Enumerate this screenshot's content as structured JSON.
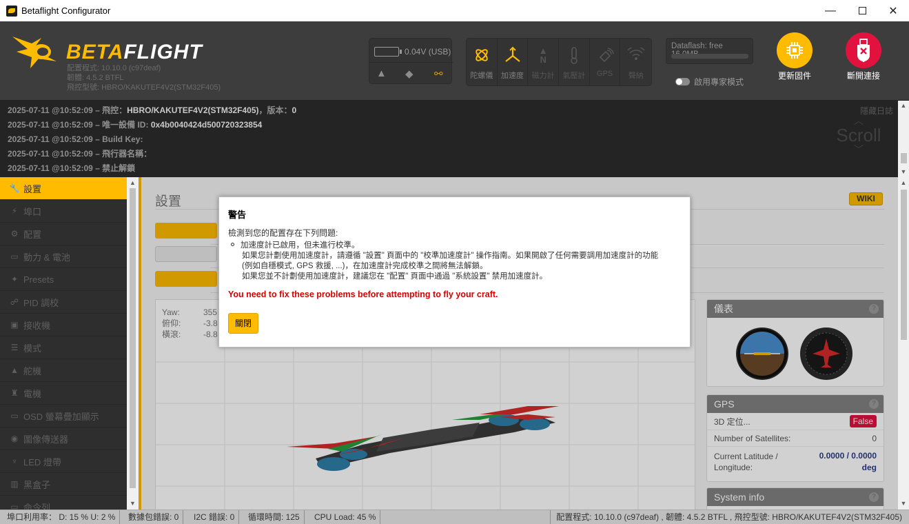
{
  "window": {
    "title": "Betaflight Configurator",
    "minimize_glyph": "—",
    "close_glyph": "✕"
  },
  "header": {
    "logo_text_a": "BETA",
    "logo_text_b": "FLIGHT",
    "info": [
      "配置程式: 10.10.0 (c97deaf)",
      "韌體: 4.5.2 BTFL",
      "飛控型號: HBRO/KAKUTEF4V2(STM32F405)"
    ],
    "battery_label": "0.04V (USB)",
    "sensors": [
      {
        "label": "陀螺儀",
        "icon": "gyro-icon",
        "active": true
      },
      {
        "label": "加速度",
        "icon": "accel-icon",
        "active": true
      },
      {
        "label": "磁力計",
        "icon": "compass-icon",
        "active": false
      },
      {
        "label": "氣壓計",
        "icon": "baro-icon",
        "active": false
      },
      {
        "label": "GPS",
        "icon": "gps-icon",
        "active": false
      },
      {
        "label": "聲納",
        "icon": "sonar-icon",
        "active": false
      }
    ],
    "dataflash_line1": "Dataflash: free",
    "dataflash_line2": "16.0MB",
    "expert_mode_label": "啟用專家模式",
    "flash_firmware_label": "更新固件",
    "disconnect_label": "斷開連接",
    "accent_color": "#ffbb00",
    "disconnect_color": "#e2123f"
  },
  "log": {
    "lines": [
      {
        "prefix": "2025-07-11 @10:52:09 – 飛控：",
        "value": "HBRO/KAKUTEF4V2(STM32F405)",
        "mid": "，版本：",
        "value2": "0"
      },
      {
        "prefix": "2025-07-11 @10:52:09 – 唯一設備 ID: ",
        "value": "0x4b0040424d500720323854",
        "mid": "",
        "value2": ""
      },
      {
        "prefix": "2025-07-11 @10:52:09 – Build Key:",
        "value": "",
        "mid": "",
        "value2": ""
      },
      {
        "prefix": "2025-07-11 @10:52:09 – 飛行器名稱：",
        "value": "",
        "mid": "",
        "value2": ""
      },
      {
        "prefix": "2025-07-11 @10:52:09 – 禁止解鎖",
        "value": "",
        "mid": "",
        "value2": ""
      }
    ],
    "hide_label": "隱藏日誌",
    "scroll_label": "Scroll"
  },
  "sidebar": {
    "items": [
      {
        "label": "設置",
        "icon": "wrench-icon",
        "glyph": "🔧",
        "active": true
      },
      {
        "label": "埠口",
        "icon": "plug-icon",
        "glyph": "⚡",
        "active": false
      },
      {
        "label": "配置",
        "icon": "gear-icon",
        "glyph": "⚙",
        "active": false
      },
      {
        "label": "動力 & 電池",
        "icon": "battery-icon",
        "glyph": "▭",
        "active": false
      },
      {
        "label": "Presets",
        "icon": "presets-icon",
        "glyph": "✦",
        "active": false
      },
      {
        "label": "PID 調校",
        "icon": "pid-icon",
        "glyph": "☍",
        "active": false
      },
      {
        "label": "接收機",
        "icon": "receiver-icon",
        "glyph": "▣",
        "active": false
      },
      {
        "label": "模式",
        "icon": "modes-icon",
        "glyph": "☰",
        "active": false
      },
      {
        "label": "舵機",
        "icon": "servo-icon",
        "glyph": "▲",
        "active": false
      },
      {
        "label": "電機",
        "icon": "motor-icon",
        "glyph": "♜",
        "active": false
      },
      {
        "label": "OSD 螢幕疊加顯示",
        "icon": "osd-icon",
        "glyph": "▭",
        "active": false
      },
      {
        "label": "圖像傳送器",
        "icon": "vtx-icon",
        "glyph": "◉",
        "active": false
      },
      {
        "label": "LED 燈帶",
        "icon": "led-icon",
        "glyph": "♆",
        "active": false
      },
      {
        "label": "黑盒子",
        "icon": "blackbox-icon",
        "glyph": "▥",
        "active": false
      },
      {
        "label": "命令列",
        "icon": "cli-icon",
        "glyph": "▭",
        "active": false
      }
    ]
  },
  "content": {
    "title": "設置",
    "wiki_label": "WIKI",
    "attitude": [
      {
        "label": "Yaw:",
        "value": "355"
      },
      {
        "label": "俯仰:",
        "value": "-3.8"
      },
      {
        "label": "橫滾:",
        "value": "-8.8"
      }
    ],
    "instruments_title": "儀表",
    "gps_title": "GPS",
    "gps_fix_label": "3D 定位...",
    "gps_fix_value": "False",
    "gps_sats_label": "Number of Satellites:",
    "gps_sats_value": "0",
    "gps_latlon_label_1": "Current Latitude /",
    "gps_latlon_label_2": "Longitude:",
    "gps_latlon_value": "0.0000 / 0.0000",
    "gps_latlon_unit": "deg",
    "sysinfo_title": "System info",
    "help_glyph": "?"
  },
  "statusbar": {
    "port_util": "埠口利用率： D: 15 % U: 2 %",
    "packet_errors": "數據包錯誤: 0",
    "i2c_errors": "I2C 錯誤: 0",
    "cycle_time": "循環時間: 125",
    "cpu_load": "CPU Load: 45 %",
    "right": "配置程式: 10.10.0 (c97deaf) , 韌體: 4.5.2 BTFL , 飛控型號: HBRO/KAKUTEF4V2(STM32F405)"
  },
  "modal": {
    "title": "警告",
    "subtitle": "檢測到您的配置存在下列問題:",
    "item_title": "加速度計已啟用，但未進行校準。",
    "item_line1": "如果您計劃使用加速度計，請遵循 \"設置\" 頁面中的 \"校準加速度計\" 操作指南。如果開啟了任何需要調用加速度計的功能",
    "item_line2": "(例如自穩模式, GPS 救援, ...)，在加速度計完成校準之間將無法解鎖。",
    "item_line3": "如果您並不計劃使用加速度計，建議您在 \"配置\" 頁面中通過 \"系統設置\" 禁用加速度計。",
    "warning": "You need to fix these problems before attempting to fly your craft.",
    "close_label": "關閉"
  }
}
